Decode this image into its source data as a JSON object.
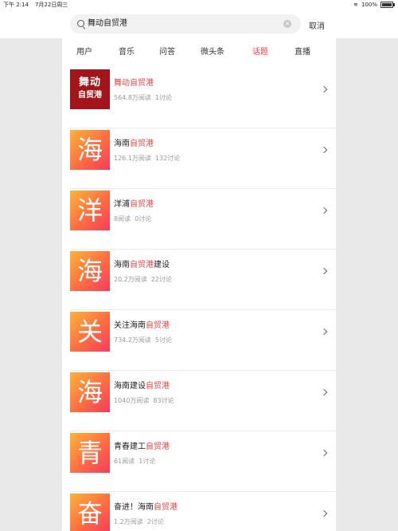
{
  "status": {
    "time": "下午 2:14",
    "date": "7月22日周三",
    "battery": "100%",
    "wifi_icon": "wifi-icon"
  },
  "search": {
    "value": "舞动自贸港",
    "clear_icon": "clear-icon"
  },
  "cancel_label": "取消",
  "tabs": [
    {
      "label": "用户",
      "active": false
    },
    {
      "label": "音乐",
      "active": false
    },
    {
      "label": "问答",
      "active": false
    },
    {
      "label": "微头条",
      "active": false
    },
    {
      "label": "话题",
      "active": true
    },
    {
      "label": "直播",
      "active": false
    }
  ],
  "accent_color": "#f04142",
  "results": [
    {
      "thumb": "",
      "brand_line1": "舞动",
      "brand_line2": "自贸港",
      "title_pre": "",
      "title_hl": "舞动自贸港",
      "title_post": "",
      "reads": "564.8万阅读",
      "discussions": "1讨论"
    },
    {
      "thumb": "海",
      "title_pre": "海南",
      "title_hl": "自贸港",
      "title_post": "",
      "reads": "126.1万阅读",
      "discussions": "132讨论"
    },
    {
      "thumb": "洋",
      "title_pre": "洋浦",
      "title_hl": "自贸港",
      "title_post": "",
      "reads": "8阅读",
      "discussions": "0讨论"
    },
    {
      "thumb": "海",
      "title_pre": "海南",
      "title_hl": "自贸港",
      "title_post": "建设",
      "reads": "20.2万阅读",
      "discussions": "22讨论"
    },
    {
      "thumb": "关",
      "title_pre": "关注海南",
      "title_hl": "自贸港",
      "title_post": "",
      "reads": "734.2万阅读",
      "discussions": "5讨论"
    },
    {
      "thumb": "海",
      "title_pre": "海南建设",
      "title_hl": "自贸港",
      "title_post": "",
      "reads": "1040万阅读",
      "discussions": "83讨论"
    },
    {
      "thumb": "青",
      "title_pre": "青春建工",
      "title_hl": "自贸港",
      "title_post": "",
      "reads": "61阅读",
      "discussions": "1讨论"
    },
    {
      "thumb": "奋",
      "title_pre": "奋进！海南",
      "title_hl": "自贸港",
      "title_post": "",
      "reads": "1.2万阅读",
      "discussions": "2讨论"
    }
  ]
}
